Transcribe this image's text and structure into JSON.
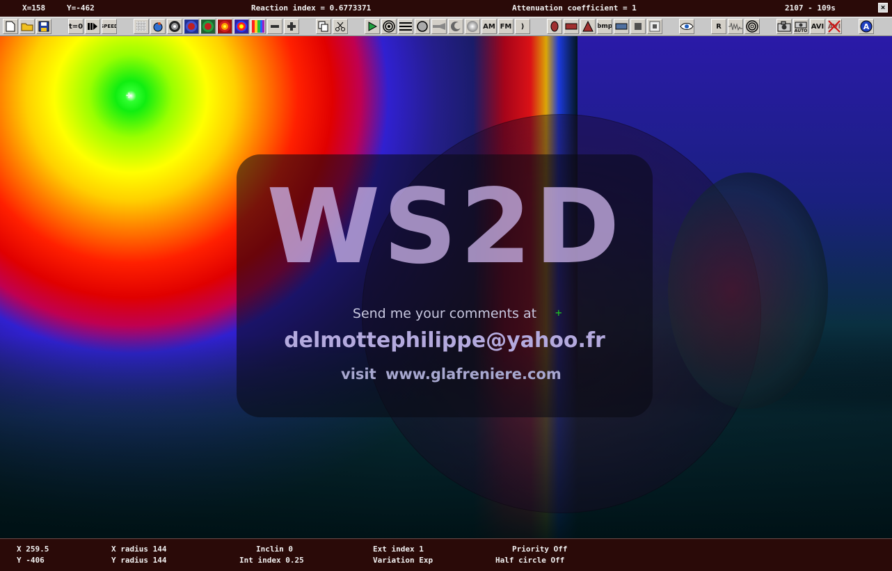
{
  "topbar": {
    "x": "X=158",
    "y": "Y=-462",
    "reaction_index": "Reaction index = 0.6773371",
    "attenuation": "Attenuation coefficient = 1",
    "frame_time": "2107 - 109s",
    "close_label": "×"
  },
  "toolbar": {
    "t0_label": "t=0",
    "speed_label": "SPEED",
    "am_label": "AM",
    "fm_label": "FM",
    "paren_label": ")",
    "bmp_label": "bmp",
    "r_label": "R",
    "avi_label": "AVI",
    "avi_off_label": "AVI",
    "auto_label": "AUTO",
    "a_label": "A"
  },
  "splash": {
    "title": "WS2D",
    "line1": "Send me your comments at",
    "plus": "+",
    "email": "delmottephilippe@yahoo.fr",
    "visit": "visit",
    "url": "www.glafreniere.com"
  },
  "bottombar": {
    "x": "X 259.5",
    "y": "Y -406",
    "x_radius": "X radius 144",
    "y_radius": "Y radius 144",
    "inclin": "Inclin 0",
    "int_index": "Int index 0.25",
    "ext_index": "Ext index 1",
    "variation": "Variation Exp",
    "priority": "Priority Off",
    "half_circle": "Half circle Off"
  },
  "colors": {
    "status_bg": "#2a0a08",
    "toolbar_bg": "#c8c8c8",
    "splash_text": "#b4aade"
  }
}
